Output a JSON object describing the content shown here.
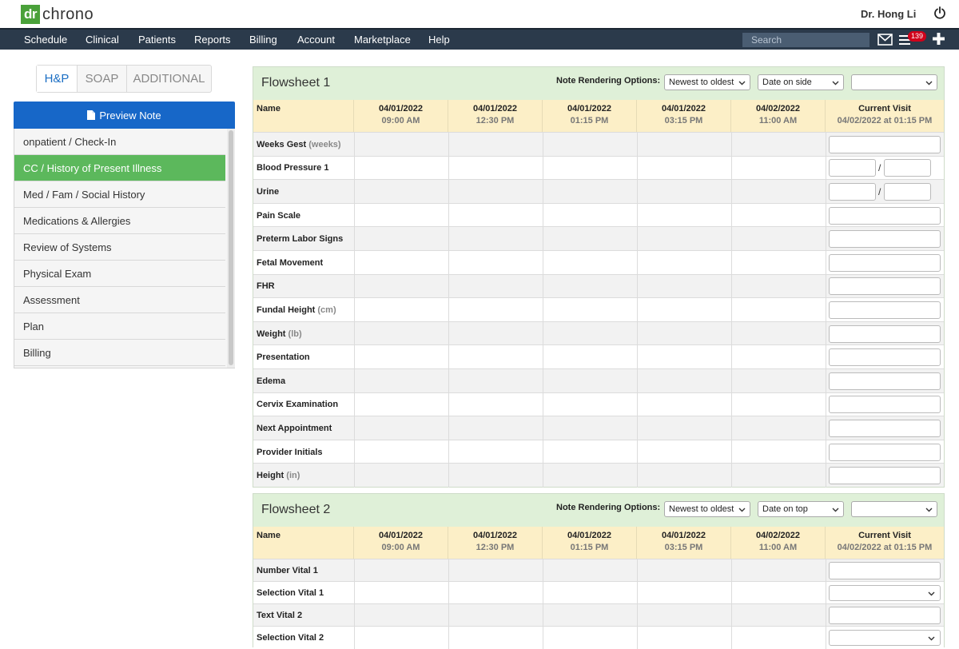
{
  "brand": {
    "logo_mark": "dr",
    "logo_text": "chrono"
  },
  "user": {
    "name": "Dr. Hong Li"
  },
  "nav": {
    "items": [
      "Schedule",
      "Clinical",
      "Patients",
      "Reports",
      "Billing",
      "Account",
      "Marketplace",
      "Help"
    ],
    "search_placeholder": "Search",
    "badge_count": "139"
  },
  "tabs": [
    {
      "label": "H&P",
      "active": true
    },
    {
      "label": "SOAP",
      "active": false
    },
    {
      "label": "ADDITIONAL",
      "active": false
    }
  ],
  "preview_label": "Preview Note",
  "sections": [
    {
      "label": "onpatient / Check-In",
      "active": false
    },
    {
      "label": "CC / History of Present Illness",
      "active": true
    },
    {
      "label": "Med / Fam / Social History",
      "active": false
    },
    {
      "label": "Medications & Allergies",
      "active": false
    },
    {
      "label": "Review of Systems",
      "active": false
    },
    {
      "label": "Physical Exam",
      "active": false
    },
    {
      "label": "Assessment",
      "active": false
    },
    {
      "label": "Plan",
      "active": false
    },
    {
      "label": "Billing",
      "active": false
    }
  ],
  "flowsheets": [
    {
      "title": "Flowsheet 1",
      "options_label": "Note Rendering Options:",
      "sort_value": "Newest to oldest",
      "date_value": "Date on side",
      "extra_value": "",
      "name_header": "Name",
      "columns": [
        {
          "date": "04/01/2022",
          "time": "09:00 AM"
        },
        {
          "date": "04/01/2022",
          "time": "12:30 PM"
        },
        {
          "date": "04/01/2022",
          "time": "01:15 PM"
        },
        {
          "date": "04/01/2022",
          "time": "03:15 PM"
        },
        {
          "date": "04/02/2022",
          "time": "11:00 AM"
        }
      ],
      "current": {
        "label": "Current Visit",
        "sub": "04/02/2022 at 01:15 PM"
      },
      "rows": [
        {
          "name": "Weeks Gest",
          "unit": "(weeks)",
          "input": "text"
        },
        {
          "name": "Blood Pressure 1",
          "unit": "",
          "input": "split"
        },
        {
          "name": "Urine",
          "unit": "",
          "input": "split"
        },
        {
          "name": "Pain Scale",
          "unit": "",
          "input": "text"
        },
        {
          "name": "Preterm Labor Signs",
          "unit": "",
          "input": "text"
        },
        {
          "name": "Fetal Movement",
          "unit": "",
          "input": "text"
        },
        {
          "name": "FHR",
          "unit": "",
          "input": "text"
        },
        {
          "name": "Fundal Height",
          "unit": "(cm)",
          "input": "text"
        },
        {
          "name": "Weight",
          "unit": "(lb)",
          "input": "text"
        },
        {
          "name": "Presentation",
          "unit": "",
          "input": "text"
        },
        {
          "name": "Edema",
          "unit": "",
          "input": "text"
        },
        {
          "name": "Cervix Examination",
          "unit": "",
          "input": "text"
        },
        {
          "name": "Next Appointment",
          "unit": "",
          "input": "text"
        },
        {
          "name": "Provider Initials",
          "unit": "",
          "input": "text"
        },
        {
          "name": "Height",
          "unit": "(in)",
          "input": "text"
        }
      ]
    },
    {
      "title": "Flowsheet 2",
      "options_label": "Note Rendering Options:",
      "sort_value": "Newest to oldest",
      "date_value": "Date on top",
      "extra_value": "",
      "name_header": "Name",
      "columns": [
        {
          "date": "04/01/2022",
          "time": "09:00 AM"
        },
        {
          "date": "04/01/2022",
          "time": "12:30 PM"
        },
        {
          "date": "04/01/2022",
          "time": "01:15 PM"
        },
        {
          "date": "04/01/2022",
          "time": "03:15 PM"
        },
        {
          "date": "04/02/2022",
          "time": "11:00 AM"
        }
      ],
      "current": {
        "label": "Current Visit",
        "sub": "04/02/2022 at 01:15 PM"
      },
      "rows": [
        {
          "name": "Number Vital 1",
          "unit": "",
          "input": "text"
        },
        {
          "name": "Selection Vital 1",
          "unit": "",
          "input": "select"
        },
        {
          "name": "Text Vital 2",
          "unit": "",
          "input": "text"
        },
        {
          "name": "Selection Vital 2",
          "unit": "",
          "input": "select"
        }
      ]
    }
  ]
}
